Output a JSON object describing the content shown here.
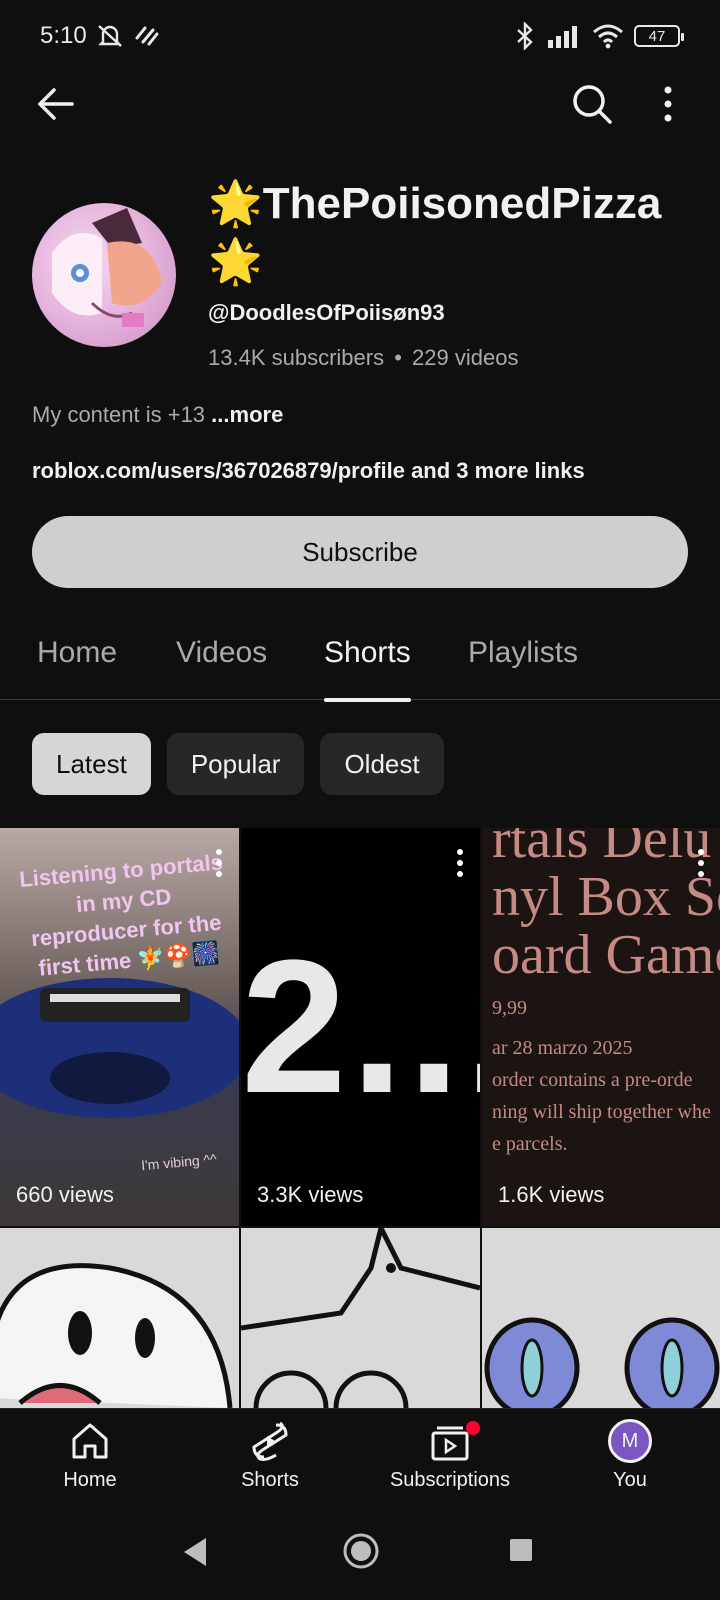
{
  "status_bar": {
    "time": "5:10",
    "battery": "47"
  },
  "channel": {
    "title_line1": "🌟ThePoiisonedPizza",
    "title_line2": "🌟",
    "handle": "@DoodlesOfPoiisøn93",
    "subscribers": "13.4K subscribers",
    "separator": "•",
    "videos": "229 videos",
    "description": "My content is +13",
    "more": "...more",
    "links": "roblox.com/users/367026879/profile and 3 more links",
    "subscribe_label": "Subscribe"
  },
  "tabs": [
    "Home",
    "Videos",
    "Shorts",
    "Playlists"
  ],
  "active_tab": "Shorts",
  "chips": [
    "Latest",
    "Popular",
    "Oldest"
  ],
  "selected_chip": "Latest",
  "shorts": [
    {
      "views": "660 views",
      "caption": "Listening to portals in my CD reproducer for the first time 🧚🍄🎆",
      "overlay": "I'm vibing ^^"
    },
    {
      "views": "3.3K views",
      "overlay": "2..."
    },
    {
      "views": "1.6K views",
      "overlay_lines": [
        "rtals Delu",
        "nyl Box Se",
        "oard Game"
      ],
      "overlay_small": [
        "9,99",
        "ar 28 marzo 2025",
        "order contains a pre-orde",
        "ning will ship together whe",
        "e parcels."
      ]
    }
  ],
  "bottom_nav": {
    "home": "Home",
    "shorts": "Shorts",
    "subscriptions": "Subscriptions",
    "you": "You",
    "you_initial": "M"
  },
  "colors": {
    "background": "#0f0f0f",
    "subscribe": "#cfcfcf",
    "notification": "#ff0033",
    "avatar_you": "#7b55c2"
  }
}
